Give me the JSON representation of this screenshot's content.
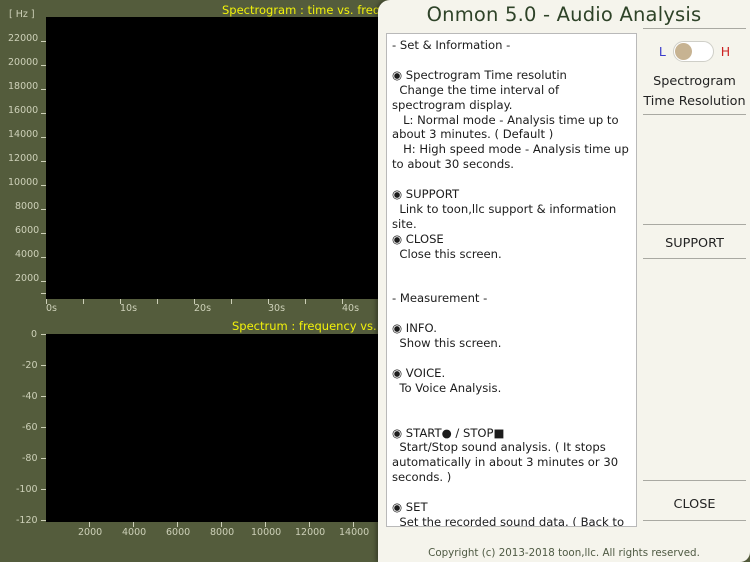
{
  "app": {
    "background_color": "#545c3c",
    "plot_color": "#000000",
    "axis_text_color": "#cdd0b8",
    "title_color": "#f2f20a"
  },
  "chart_data": [
    {
      "type": "heatmap",
      "title": "Spectrogram : time vs. frequency",
      "xlabel": "",
      "ylabel": "[ Hz ]",
      "x_ticks": [
        "0s",
        "10s",
        "20s",
        "30s",
        "40s"
      ],
      "y_ticks": [
        "22000",
        "20000",
        "18000",
        "16000",
        "14000",
        "12000",
        "10000",
        "8000",
        "6000",
        "4000",
        "2000"
      ],
      "xlim": [
        0,
        48
      ],
      "ylim": [
        0,
        24000
      ],
      "grid": false,
      "values": [],
      "note": "empty / no data plotted"
    },
    {
      "type": "line",
      "title": "Spectrum : frequency vs. power",
      "xlabel": "",
      "ylabel": "",
      "x_ticks": [
        "2000",
        "4000",
        "6000",
        "8000",
        "10000",
        "12000",
        "14000"
      ],
      "y_ticks": [
        "0",
        "-20",
        "-40",
        "-60",
        "-80",
        "-100",
        "-120"
      ],
      "xlim": [
        0,
        15500
      ],
      "ylim": [
        -120,
        0
      ],
      "grid": false,
      "values": [],
      "note": "empty / no data plotted"
    }
  ],
  "dialog": {
    "title": "Onmon 5.0 - Audio Analysis",
    "info_text": "- Set & Information -\n\n◉ Spectrogram Time resolutin\n  Change the time interval of spectrogram display.\n   L: Normal mode - Analysis time up to about 3 minutes. ( Default )\n   H: High speed mode - Analysis time up to about 30 seconds.\n\n◉ SUPPORT\n  Link to toon,llc support & information site.\n◉ CLOSE\n  Close this screen.\n\n\n- Measurement -\n\n◉ INFO.\n  Show this screen.\n\n◉ VOICE.\n  To Voice Analysis.\n\n\n◉ START● / STOP■\n  Start/Stop sound analysis. ( It stops automatically in about 3 minutes or 30 seconds. )\n\n◉ SET\n  Set the recorded sound data. ( Back to the beginning of data. )",
    "toggle": {
      "left_label": "L",
      "right_label": "H",
      "state": "L",
      "knob_color": "#c7b392",
      "left_color": "#3b3ccc",
      "right_color": "#cc2222"
    },
    "side_label_line1": "Spectrogram",
    "side_label_line2": "Time Resolution",
    "support_button": "SUPPORT",
    "close_button": "CLOSE",
    "copyright": "Copyright (c) 2013-2018 toon,llc. All rights reserved."
  }
}
